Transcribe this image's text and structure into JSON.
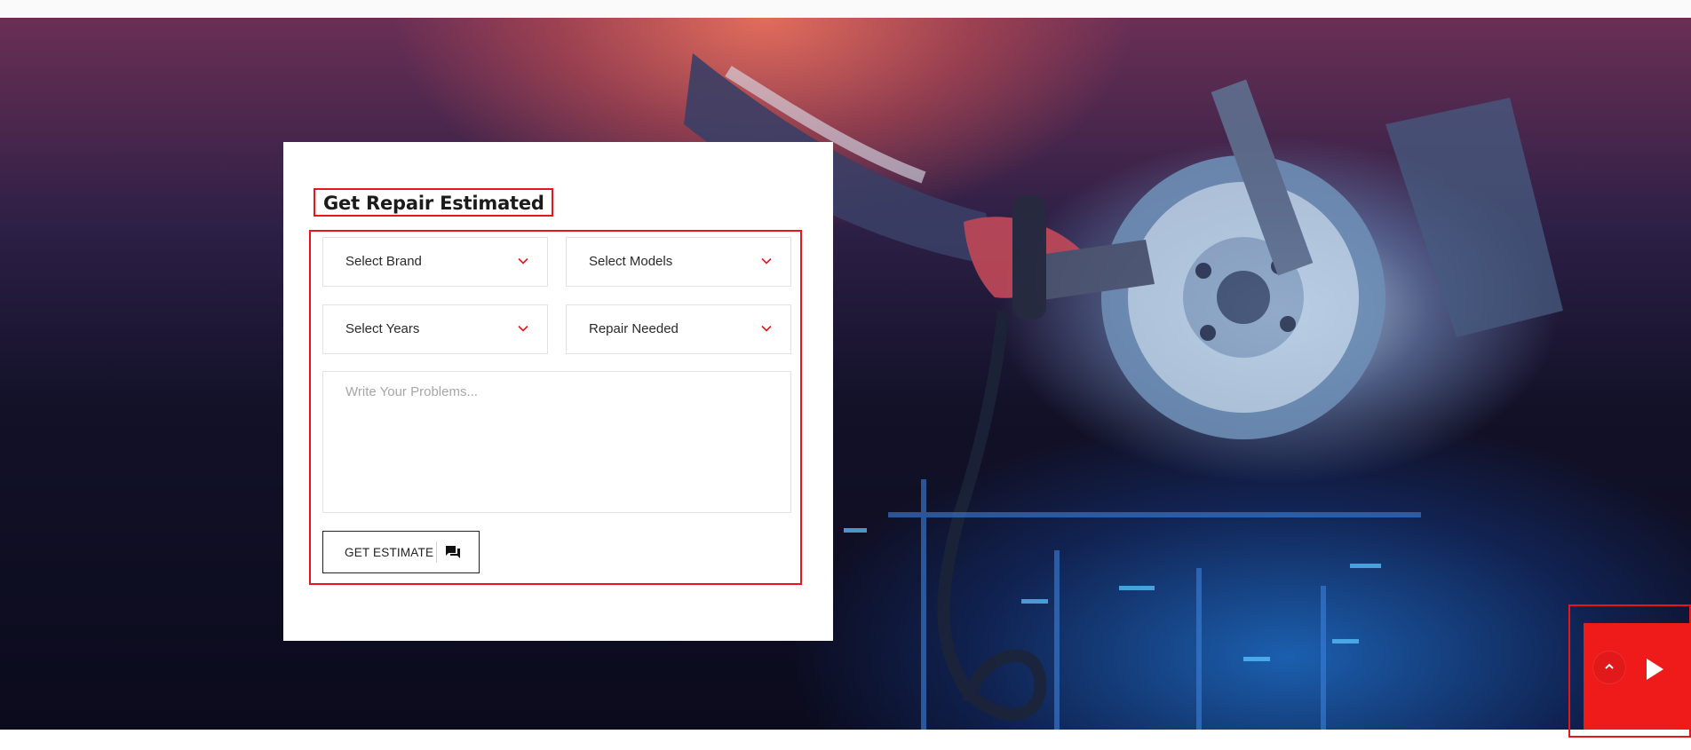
{
  "estimate_form": {
    "title": "Get Repair Estimated",
    "brand_select": "Select Brand",
    "models_select": "Select Models",
    "years_select": "Select Years",
    "repair_select": "Repair Needed",
    "problem_placeholder": "Write Your Problems...",
    "submit_label": "GET ESTIMATE"
  },
  "floating": {
    "scroll_top_icon": "chevron-up-icon",
    "play_icon": "play-icon"
  },
  "colors": {
    "accent": "#e8161b",
    "text": "#1b1b1b",
    "placeholder": "#a7a7a7"
  }
}
